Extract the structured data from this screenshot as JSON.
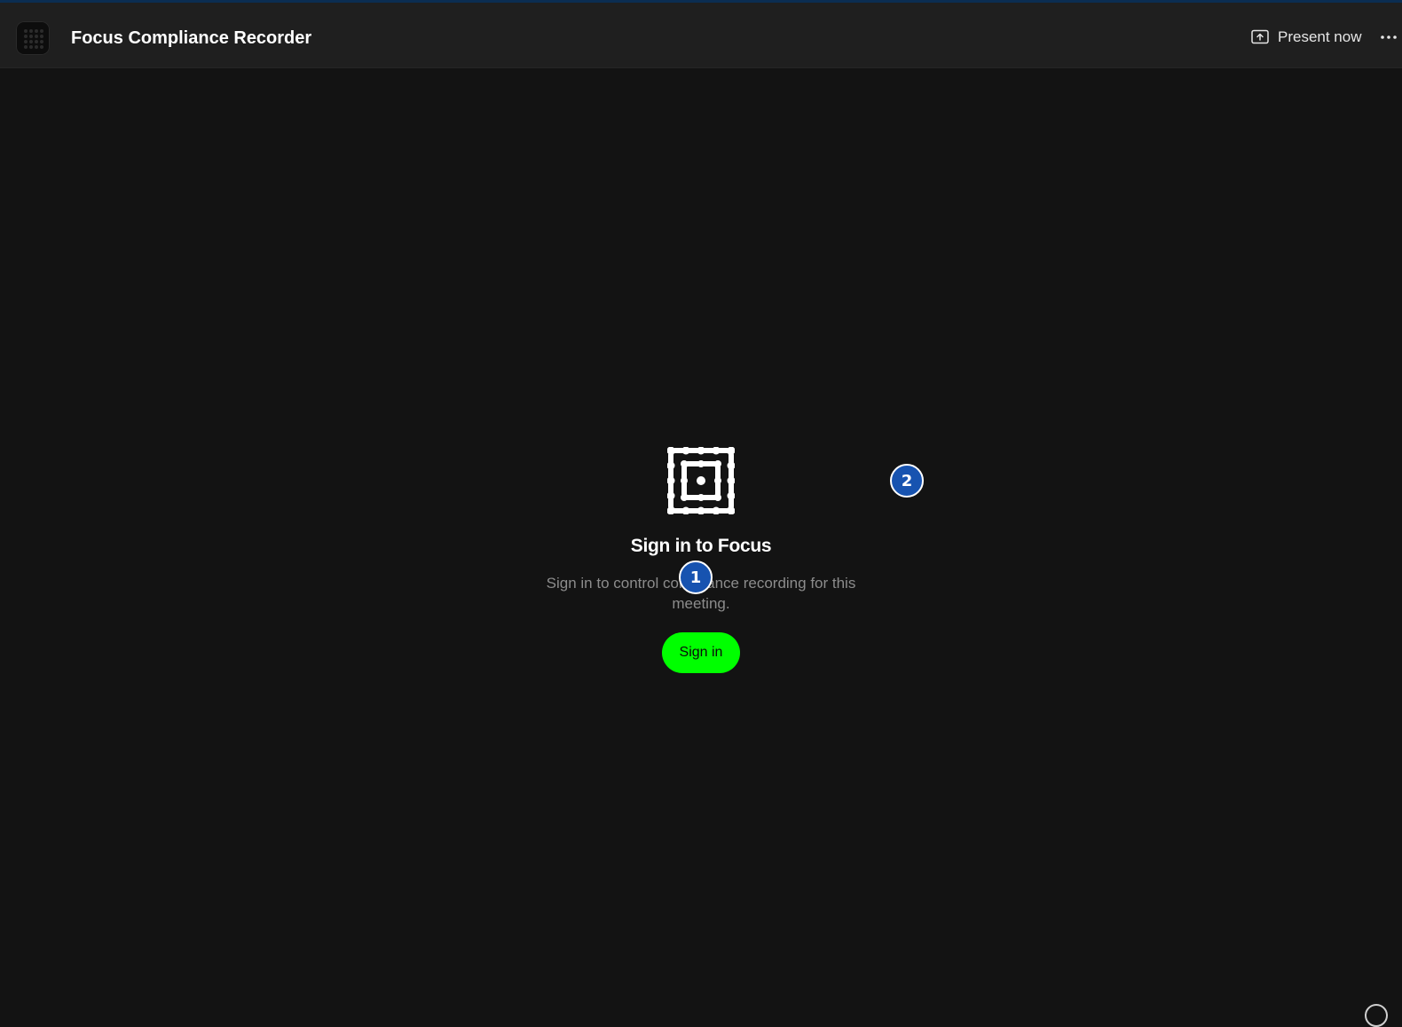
{
  "header": {
    "app_title": "Focus Compliance Recorder",
    "app_icon": "focus-app-icon",
    "present_label": "Present now",
    "present_icon": "share-screen-icon",
    "more_icon": "more-horizontal-icon"
  },
  "main": {
    "logo_icon": "focus-logo-icon",
    "title": "Sign in to Focus",
    "description": "Sign in to control compliance recording for this meeting.",
    "signin_button_label": "Sign in"
  },
  "markers": [
    {
      "label": "1"
    },
    {
      "label": "2"
    }
  ],
  "colors": {
    "background": "#131313",
    "header": "#1f1f1f",
    "accent_green": "#00ff00",
    "marker_blue": "#1753b0"
  }
}
